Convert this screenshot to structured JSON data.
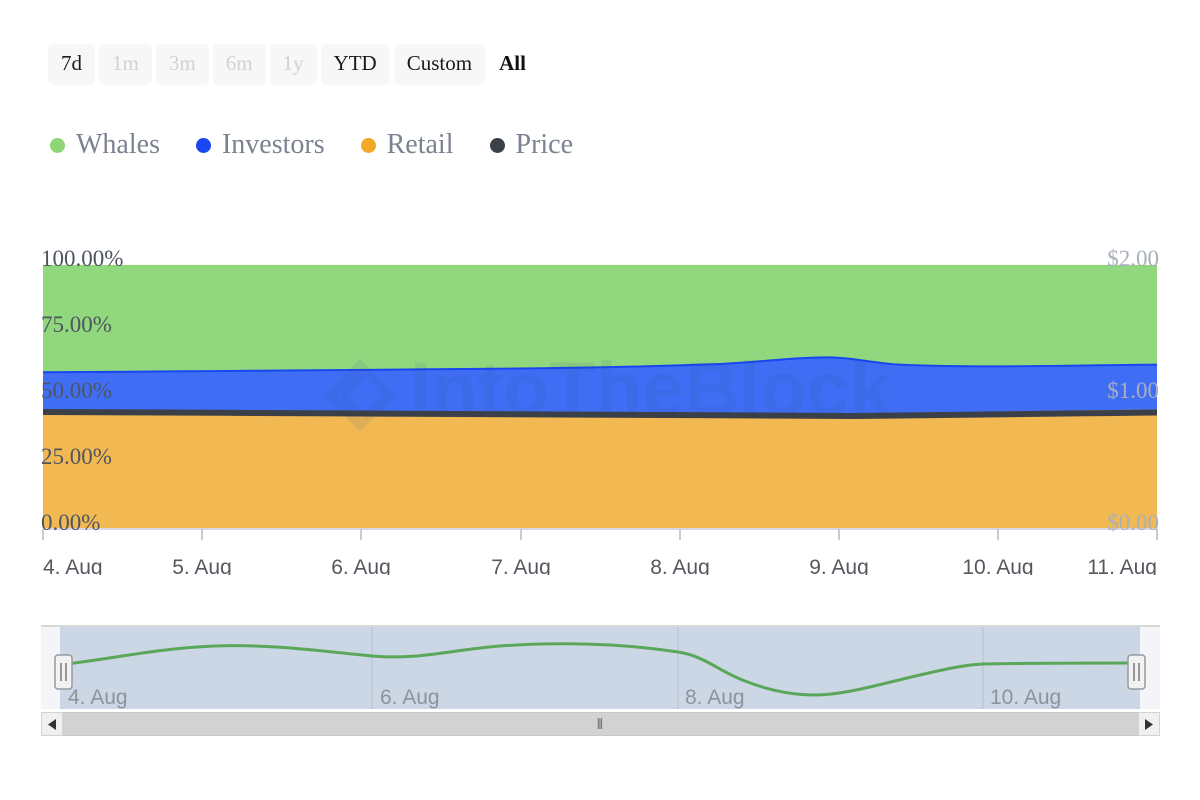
{
  "range_selector": {
    "buttons": [
      {
        "label": "7d",
        "state": "enabled"
      },
      {
        "label": "1m",
        "state": "disabled"
      },
      {
        "label": "3m",
        "state": "disabled"
      },
      {
        "label": "6m",
        "state": "disabled"
      },
      {
        "label": "1y",
        "state": "disabled"
      },
      {
        "label": "YTD",
        "state": "enabled"
      },
      {
        "label": "Custom",
        "state": "enabled"
      },
      {
        "label": "All",
        "state": "selected"
      }
    ]
  },
  "legend": {
    "items": [
      {
        "label": "Whales",
        "color": "#8fd575",
        "icon": "legend-dot-icon"
      },
      {
        "label": "Investors",
        "color": "#1846f0",
        "icon": "legend-dot-icon"
      },
      {
        "label": "Retail",
        "color": "#f2a925",
        "icon": "legend-dot-icon"
      },
      {
        "label": "Price",
        "color": "#3b4048",
        "icon": "legend-dot-icon"
      }
    ]
  },
  "watermark": {
    "text": "IntoTheBlock",
    "logo": "diamond-logo-icon"
  },
  "navigator": {
    "x_labels": [
      "4. Aug",
      "6. Aug",
      "8. Aug",
      "10. Aug"
    ],
    "series_color": "#5aa75a",
    "background": "#ccd7e6",
    "left_handle": "nav-handle-left",
    "right_handle": "nav-handle-right"
  },
  "scrollbar": {
    "left_arrow": "◀",
    "right_arrow": "▶",
    "grip": "⦀"
  },
  "chart_data": {
    "type": "area",
    "title": "",
    "subtitle": "",
    "xlabel": "",
    "ylabel": "",
    "stacked": true,
    "grid": true,
    "legend_position": "top-left",
    "x": [
      "4. Aug",
      "5. Aug",
      "6. Aug",
      "7. Aug",
      "8. Aug",
      "9. Aug",
      "10. Aug",
      "11. Aug"
    ],
    "x_tick_labels": [
      "4. Aug",
      "5. Aug",
      "6. Aug",
      "7. Aug",
      "8. Aug",
      "9. Aug",
      "10. Aug",
      "11. Aug"
    ],
    "y_left": {
      "label": "",
      "ticks": [
        0,
        25,
        50,
        75,
        100
      ],
      "tick_labels": [
        "0.00%",
        "25.00%",
        "50.00%",
        "75.00%",
        "100.00%"
      ],
      "ylim": [
        0,
        100
      ],
      "unit": "%"
    },
    "y_right": {
      "label": "",
      "ticks": [
        0,
        1,
        2
      ],
      "tick_labels": [
        "$0.00",
        "$1.00",
        "$2.00"
      ],
      "ylim": [
        0,
        2
      ],
      "unit": "$"
    },
    "series": [
      {
        "name": "Retail",
        "color": "#f2b952",
        "line_color": "#f2a925",
        "type": "area",
        "axis": "left",
        "values": [
          45.3,
          45.2,
          45.1,
          45.0,
          44.9,
          44.6,
          44.9,
          45.1
        ]
      },
      {
        "name": "Investors",
        "color": "#3f6ef5",
        "line_color": "#1846f0",
        "type": "area",
        "axis": "left",
        "values": [
          16.7,
          16.8,
          17.0,
          17.1,
          17.3,
          18.4,
          17.6,
          17.4
        ]
      },
      {
        "name": "Whales",
        "color": "#91d77d",
        "line_color": "#8fd575",
        "type": "area",
        "axis": "left",
        "values": [
          38.0,
          38.0,
          37.9,
          37.9,
          37.8,
          37.0,
          37.5,
          37.5
        ]
      },
      {
        "name": "Price",
        "color": "#3b4048",
        "type": "line",
        "axis": "right",
        "values": [
          0.885,
          0.883,
          0.882,
          0.88,
          0.878,
          0.876,
          0.88,
          0.882
        ]
      }
    ],
    "navigator_series": {
      "name": "Whales",
      "color": "#5aa75a",
      "x": [
        "4. Aug",
        "5. Aug",
        "6. Aug",
        "7. Aug",
        "8. Aug",
        "9. Aug",
        "10. Aug",
        "11. Aug"
      ],
      "values": [
        38.0,
        40.5,
        39.4,
        40.6,
        39.9,
        33.5,
        37.6,
        37.7
      ]
    }
  }
}
